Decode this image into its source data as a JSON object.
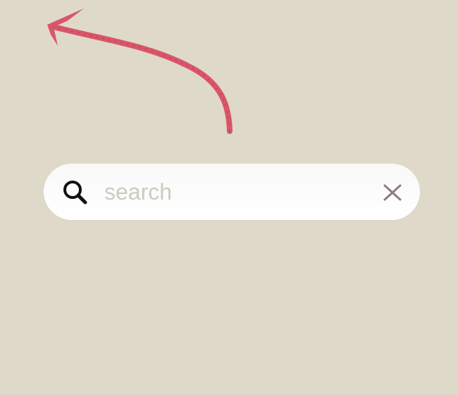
{
  "search": {
    "placeholder": "search",
    "value": "",
    "search_icon": "search-icon",
    "clear_icon": "close-icon"
  },
  "annotation": {
    "icon": "curved-arrow-icon",
    "color": "#d9566a"
  },
  "colors": {
    "background": "#dfd9c9",
    "search_background": "#ffffff",
    "placeholder": "#cfcac0",
    "icon": "#111111",
    "clear_icon": "#8a7d82"
  }
}
